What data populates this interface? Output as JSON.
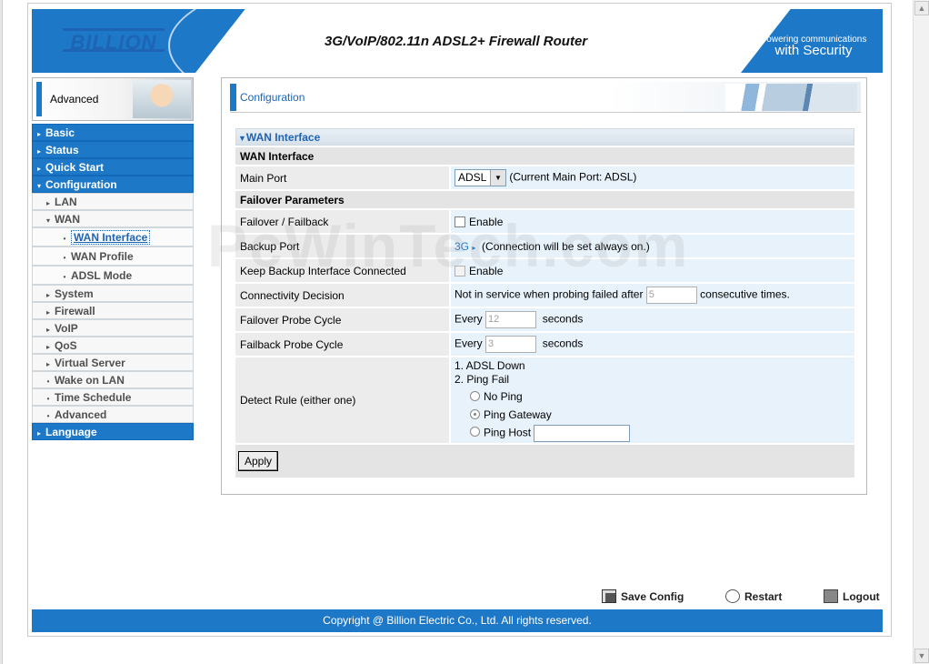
{
  "banner": {
    "logo": "BILLION",
    "product_title": "3G/VoIP/802.11n ADSL2+ Firewall Router",
    "tagline_1": "Powering communications",
    "tagline_2": "with Security"
  },
  "sidebar": {
    "section_label": "Advanced",
    "menu": {
      "basic": "Basic",
      "status": "Status",
      "quick_start": "Quick Start",
      "configuration": "Configuration",
      "lan": "LAN",
      "wan": "WAN",
      "wan_interface": "WAN Interface",
      "wan_profile": "WAN Profile",
      "adsl_mode": "ADSL Mode",
      "system": "System",
      "firewall": "Firewall",
      "voip": "VoIP",
      "qos": "QoS",
      "virtual_server": "Virtual Server",
      "wake_on_lan": "Wake on LAN",
      "time_schedule": "Time Schedule",
      "advanced": "Advanced",
      "language": "Language"
    }
  },
  "panel": {
    "title": "Configuration",
    "section_title": "WAN Interface",
    "wan_group": "WAN Interface",
    "main_port": {
      "label": "Main Port",
      "value": "ADSL",
      "note": "(Current Main Port: ADSL)"
    },
    "failover_group": "Failover Parameters",
    "failover": {
      "label": "Failover / Failback",
      "checkbox_label": "Enable",
      "checked": false
    },
    "backup_port": {
      "label": "Backup Port",
      "value": "3G",
      "note": "(Connection will be set always on.)"
    },
    "keep_backup": {
      "label": "Keep Backup Interface Connected",
      "checkbox_label": "Enable",
      "checked": false
    },
    "connectivity": {
      "label": "Connectivity Decision",
      "prefix": "Not in service when probing failed after",
      "value": "5",
      "suffix": "consecutive times."
    },
    "failover_probe": {
      "label": "Failover Probe Cycle",
      "prefix": "Every",
      "value": "12",
      "suffix": "seconds"
    },
    "failback_probe": {
      "label": "Failback Probe Cycle",
      "prefix": "Every",
      "value": "3",
      "suffix": "seconds"
    },
    "detect_rule": {
      "label": "Detect Rule (either one)",
      "rule1": "1. ADSL Down",
      "rule2": "2. Ping Fail",
      "opt_no_ping": "No Ping",
      "opt_ping_gateway": "Ping Gateway",
      "opt_ping_host": "Ping Host",
      "selected": "Ping Gateway",
      "ping_host_value": ""
    },
    "apply_label": "Apply"
  },
  "bottom": {
    "save_config": "Save Config",
    "restart": "Restart",
    "logout": "Logout",
    "copyright": "Copyright @ Billion Electric Co., Ltd. All rights reserved."
  },
  "watermark": "PcWinTech.com",
  "colors": {
    "brand_blue": "#1e78c8",
    "row_label_bg": "#ececec",
    "row_value_bg": "#e8f2fb"
  }
}
